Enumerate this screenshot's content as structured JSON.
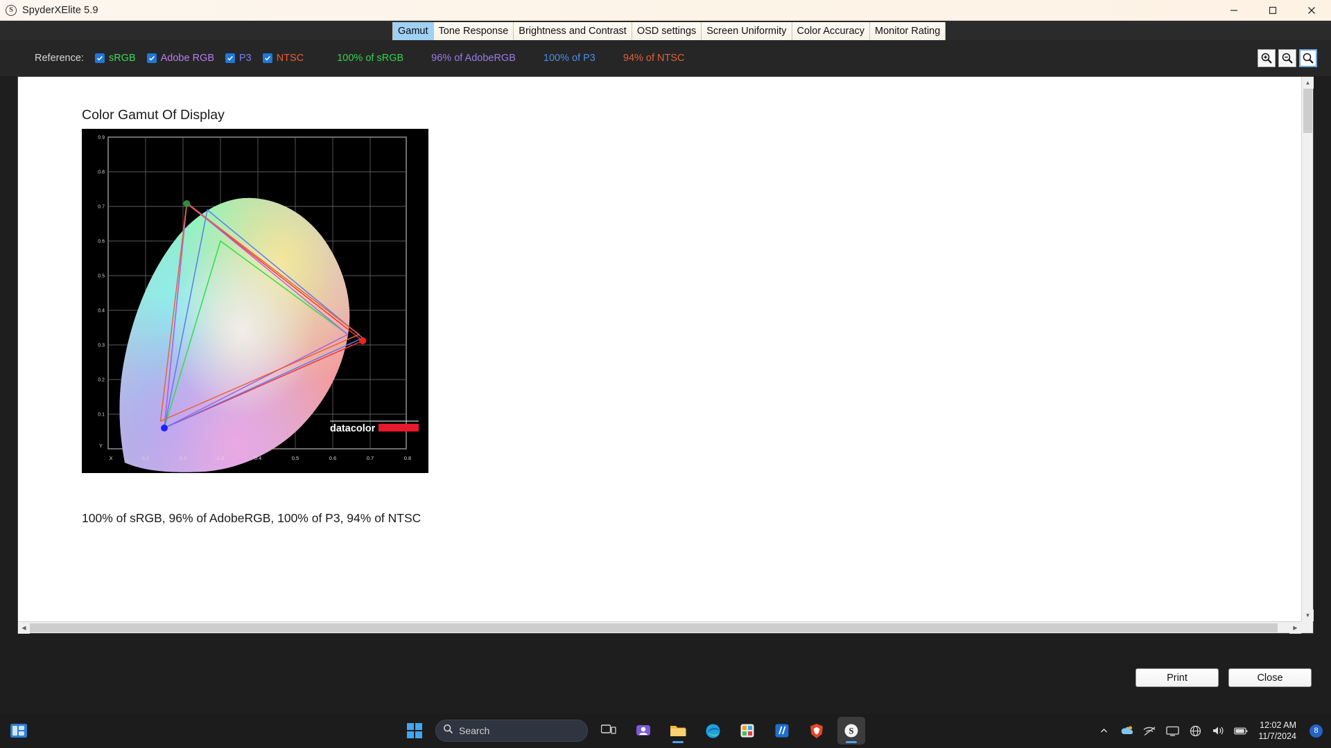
{
  "window": {
    "title": "SpyderXElite 5.9",
    "icon": "spyder-app-icon",
    "minimize": "–",
    "maximize": "❐",
    "close": "✕"
  },
  "tabs": [
    {
      "label": "Gamut",
      "active": true
    },
    {
      "label": "Tone Response",
      "active": false
    },
    {
      "label": "Brightness and Contrast",
      "active": false
    },
    {
      "label": "OSD settings",
      "active": false
    },
    {
      "label": "Screen Uniformity",
      "active": false
    },
    {
      "label": "Color Accuracy",
      "active": false
    },
    {
      "label": "Monitor Rating",
      "active": false
    }
  ],
  "toolbar": {
    "reference_label": "Reference:",
    "checkboxes": [
      {
        "label": "sRGB",
        "checked": true,
        "color": "#3ddc5b"
      },
      {
        "label": "Adobe RGB",
        "checked": true,
        "color": "#b77df0"
      },
      {
        "label": "P3",
        "checked": true,
        "color": "#7b7bf5"
      },
      {
        "label": "NTSC",
        "checked": true,
        "color": "#f05a32"
      }
    ],
    "percentages": [
      {
        "text": "100% of sRGB",
        "color": "#2fd44f"
      },
      {
        "text": "96% of AdobeRGB",
        "color": "#9b7bea"
      },
      {
        "text": "100% of P3",
        "color": "#4d8ce8"
      },
      {
        "text": "94% of NTSC",
        "color": "#e0613a"
      }
    ],
    "zoom_tools": [
      {
        "name": "zoom-in-icon",
        "selected": false
      },
      {
        "name": "zoom-out-icon",
        "selected": false
      },
      {
        "name": "zoom-fit-icon",
        "selected": true
      }
    ]
  },
  "document": {
    "title": "Color Gamut Of Display",
    "caption": "100% of sRGB, 96% of AdobeRGB, 100% of P3, 94% of NTSC",
    "watermark": "datacolor"
  },
  "chart_data": {
    "type": "scatter",
    "title": "Color Gamut Of Display",
    "xlabel": "X",
    "ylabel": "Y",
    "xlim": [
      0.0,
      0.85
    ],
    "ylim": [
      0.0,
      0.92
    ],
    "xticks": [
      0.1,
      0.2,
      0.3,
      0.4,
      0.5,
      0.6,
      0.7,
      0.8
    ],
    "xticklabels": [
      "0.1",
      "0.2",
      "0.3",
      "0.4",
      "0.5",
      "0.6",
      "0.7",
      "0.8"
    ],
    "yticks": [
      0.1,
      0.2,
      0.3,
      0.4,
      0.5,
      0.6,
      0.7,
      0.8,
      0.9
    ],
    "yticklabels": [
      "0.1",
      "0.2",
      "0.3",
      "0.4",
      "0.5",
      "0.6",
      "0.7",
      "0.8",
      "0.9"
    ],
    "grid": true,
    "background": "#000000",
    "series": [
      {
        "name": "Display",
        "type": "gamut-triangle",
        "color": "#ff2f2f",
        "points": [
          {
            "label": "red",
            "x": 0.68,
            "y": 0.312
          },
          {
            "label": "green",
            "x": 0.21,
            "y": 0.708
          },
          {
            "label": "blue",
            "x": 0.15,
            "y": 0.06
          }
        ],
        "measured_vertices": true
      },
      {
        "name": "sRGB",
        "type": "gamut-triangle",
        "color": "#29e04a",
        "points": [
          {
            "label": "red",
            "x": 0.64,
            "y": 0.33
          },
          {
            "label": "green",
            "x": 0.3,
            "y": 0.6
          },
          {
            "label": "blue",
            "x": 0.15,
            "y": 0.06
          }
        ]
      },
      {
        "name": "Adobe RGB",
        "type": "gamut-triangle",
        "color": "#b061e8",
        "points": [
          {
            "label": "red",
            "x": 0.64,
            "y": 0.33
          },
          {
            "label": "green",
            "x": 0.21,
            "y": 0.71
          },
          {
            "label": "blue",
            "x": 0.15,
            "y": 0.06
          }
        ]
      },
      {
        "name": "P3",
        "type": "gamut-triangle",
        "color": "#5a7bf0",
        "points": [
          {
            "label": "red",
            "x": 0.68,
            "y": 0.32
          },
          {
            "label": "green",
            "x": 0.265,
            "y": 0.69
          },
          {
            "label": "blue",
            "x": 0.15,
            "y": 0.06
          }
        ]
      },
      {
        "name": "NTSC",
        "type": "gamut-triangle",
        "color": "#e8623a",
        "points": [
          {
            "label": "red",
            "x": 0.67,
            "y": 0.33
          },
          {
            "label": "green",
            "x": 0.21,
            "y": 0.71
          },
          {
            "label": "blue",
            "x": 0.14,
            "y": 0.08
          }
        ]
      }
    ],
    "markers": [
      {
        "label": "red-primary",
        "x": 0.68,
        "y": 0.312,
        "color": "#ff2020"
      },
      {
        "label": "green-primary",
        "x": 0.21,
        "y": 0.708,
        "color": "#2f8f3f"
      },
      {
        "label": "blue-primary",
        "x": 0.15,
        "y": 0.06,
        "color": "#2020ff"
      }
    ]
  },
  "scrollbars": {
    "v_up": "▲",
    "v_down": "▼",
    "h_left": "◀",
    "h_right": "▶"
  },
  "footer": {
    "print_label": "Print",
    "close_label": "Close"
  },
  "taskbar": {
    "search_placeholder": "Search",
    "apps": [
      {
        "name": "taskview-icon",
        "running": false
      },
      {
        "name": "teams-icon",
        "running": false
      },
      {
        "name": "file-explorer-icon",
        "running": true
      },
      {
        "name": "edge-icon",
        "running": false
      },
      {
        "name": "store-icon",
        "running": false
      },
      {
        "name": "calculator-icon",
        "running": false
      },
      {
        "name": "brave-icon",
        "running": false
      },
      {
        "name": "spyder-icon",
        "running": true
      }
    ],
    "tray": {
      "chevron": "⌃",
      "time": "12:02 AM",
      "date": "11/7/2024",
      "notification_count": "8"
    }
  }
}
